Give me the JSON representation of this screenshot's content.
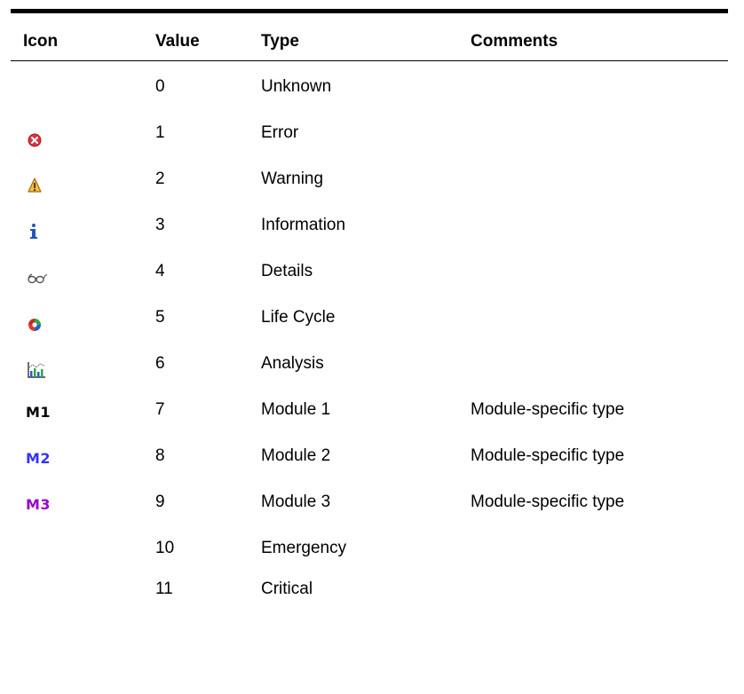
{
  "table": {
    "headers": {
      "icon": "Icon",
      "value": "Value",
      "type": "Type",
      "comments": "Comments"
    },
    "rows": [
      {
        "icon": "",
        "value": "0",
        "type": "Unknown",
        "comments": ""
      },
      {
        "icon": "error-icon",
        "value": "1",
        "type": "Error",
        "comments": ""
      },
      {
        "icon": "warning-icon",
        "value": "2",
        "type": "Warning",
        "comments": ""
      },
      {
        "icon": "information-icon",
        "value": "3",
        "type": "Information",
        "comments": ""
      },
      {
        "icon": "details-glasses-icon",
        "value": "4",
        "type": "Details",
        "comments": ""
      },
      {
        "icon": "life-cycle-icon",
        "value": "5",
        "type": "Life Cycle",
        "comments": ""
      },
      {
        "icon": "analysis-chart-icon",
        "value": "6",
        "type": "Analysis",
        "comments": ""
      },
      {
        "icon": "module-1-icon",
        "icon_text": "M1",
        "icon_color": "#000000",
        "value": "7",
        "type": "Module 1",
        "comments": "Module-specific type"
      },
      {
        "icon": "module-2-icon",
        "icon_text": "M2",
        "icon_color": "#3333ff",
        "value": "8",
        "type": "Module 2",
        "comments": "Module-specific type"
      },
      {
        "icon": "module-3-icon",
        "icon_text": "M3",
        "icon_color": "#9900cc",
        "value": "9",
        "type": "Module 3",
        "comments": "Module-specific type"
      },
      {
        "icon": "",
        "value": "10",
        "type": "Emergency",
        "comments": ""
      },
      {
        "icon": "",
        "value": "11",
        "type": "Critical",
        "comments": ""
      }
    ]
  }
}
